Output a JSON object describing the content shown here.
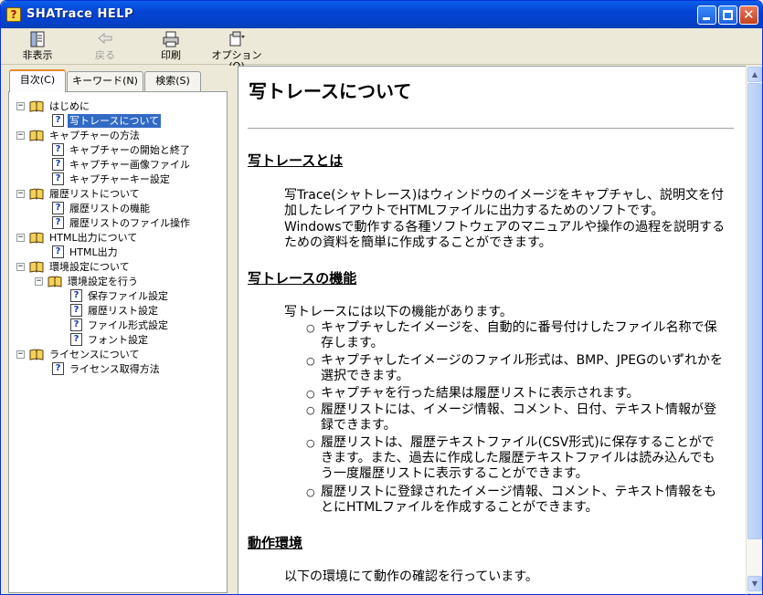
{
  "window": {
    "title": "SHATrace HELP"
  },
  "toolbar": {
    "hide": "非表示",
    "back": "戻る",
    "print": "印刷",
    "options": "オプション(O)"
  },
  "tabs": {
    "contents": "目次(C)",
    "keyword": "キーワード(N)",
    "search": "検索(S)"
  },
  "tree": {
    "intro": "はじめに",
    "about": "写トレースについて",
    "capture": "キャプチャーの方法",
    "cap_start": "キャプチャーの開始と終了",
    "cap_file": "キャプチャー画像ファイル",
    "cap_key": "キャプチャーキー設定",
    "history": "履歴リストについて",
    "hist_func": "履歴リストの機能",
    "hist_file": "履歴リストのファイル操作",
    "html": "HTML出力について",
    "html_out": "HTML出力",
    "env": "環境設定について",
    "env_do": "環境設定を行う",
    "env_save": "保存ファイル設定",
    "env_hist": "履歴リスト設定",
    "env_fmt": "ファイル形式設定",
    "env_font": "フォント設定",
    "license": "ライセンスについて",
    "lic_get": "ライセンス取得方法"
  },
  "content": {
    "title": "写トレースについて",
    "s1_heading": "写トレースとは",
    "s1_p1": "写Trace(シャトレース)はウィンドウのイメージをキャプチャし、説明文を付加したレイアウトでHTMLファイルに出力するためのソフトです。",
    "s1_p2": "Windowsで動作する各種ソフトウェアのマニュアルや操作の過程を説明するための資料を簡単に作成することができます。",
    "s2_heading": "写トレースの機能",
    "s2_intro": "写トレースには以下の機能があります。",
    "features": [
      "キャプチャしたイメージを、自動的に番号付けしたファイル名称で保存します。",
      "キャプチャしたイメージのファイル形式は、BMP、JPEGのいずれかを選択できます。",
      "キャプチャを行った結果は履歴リストに表示されます。",
      "履歴リストには、イメージ情報、コメント、日付、テキスト情報が登録できます。",
      "履歴リストは、履歴テキストファイル(CSV形式)に保存することができます。また、過去に作成した履歴テキストファイルは読み込んでもう一度履歴リストに表示することができます。",
      "履歴リストに登録されたイメージ情報、コメント、テキスト情報をもとにHTMLファイルを作成することができます。"
    ],
    "s3_heading": "動作環境",
    "s3_intro": "以下の環境にて動作の確認を行っています。"
  }
}
